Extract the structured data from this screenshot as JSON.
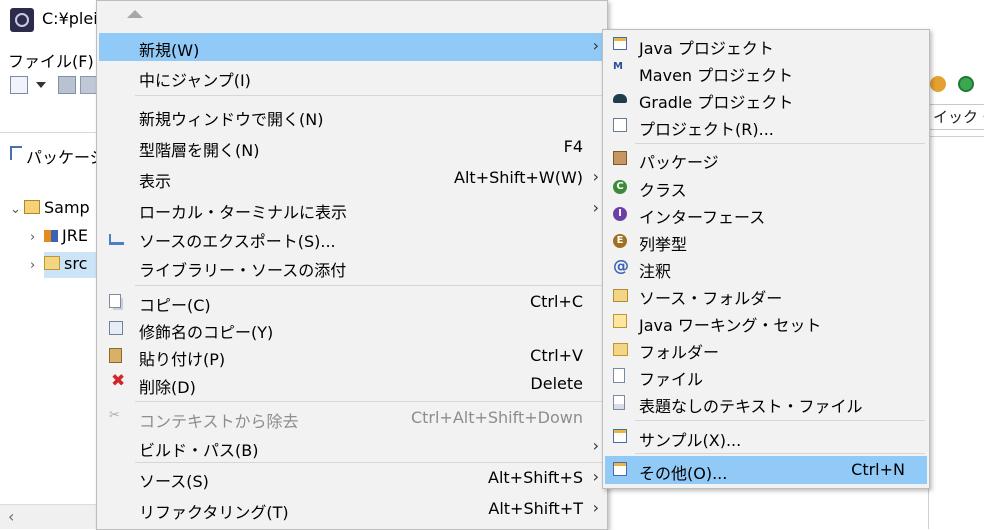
{
  "window": {
    "title": "C:¥plei",
    "menu_file": "ファイル(F)",
    "quick_access": "イック・ア",
    "package_tab": "パッケージ",
    "tree": {
      "project": "Samp",
      "jre": "JRE",
      "src": "src"
    }
  },
  "context_menu": {
    "items": [
      {
        "label": "新規(W)",
        "shortcut": "",
        "submenu": true
      },
      {
        "label": "中にジャンプ(I)",
        "shortcut": ""
      },
      {
        "label": "新規ウィンドウで開く(N)",
        "shortcut": ""
      },
      {
        "label": "型階層を開く(N)",
        "shortcut": "F4"
      },
      {
        "label": "表示",
        "shortcut": "Alt+Shift+W(W)",
        "submenu": true
      },
      {
        "label": "ローカル・ターミナルに表示",
        "shortcut": "",
        "submenu": true
      },
      {
        "label": "ソースのエクスポート(S)...",
        "shortcut": ""
      },
      {
        "label": "ライブラリー・ソースの添付",
        "shortcut": ""
      },
      {
        "label": "コピー(C)",
        "shortcut": "Ctrl+C"
      },
      {
        "label": "修飾名のコピー(Y)",
        "shortcut": ""
      },
      {
        "label": "貼り付け(P)",
        "shortcut": "Ctrl+V"
      },
      {
        "label": "削除(D)",
        "shortcut": "Delete"
      },
      {
        "label": "コンテキストから除去",
        "shortcut": "Ctrl+Alt+Shift+Down",
        "disabled": true
      },
      {
        "label": "ビルド・パス(B)",
        "shortcut": "",
        "submenu": true
      },
      {
        "label": "ソース(S)",
        "shortcut": "Alt+Shift+S",
        "submenu": true
      },
      {
        "label": "リファクタリング(T)",
        "shortcut": "Alt+Shift+T",
        "submenu": true
      }
    ],
    "submenu_arrow": "›"
  },
  "new_submenu": {
    "items": [
      {
        "label": "Java プロジェクト"
      },
      {
        "label": "Maven プロジェクト"
      },
      {
        "label": "Gradle プロジェクト"
      },
      {
        "label": "プロジェクト(R)..."
      },
      {
        "label": "パッケージ"
      },
      {
        "label": "クラス"
      },
      {
        "label": "インターフェース"
      },
      {
        "label": "列挙型"
      },
      {
        "label": "注釈"
      },
      {
        "label": "ソース・フォルダー"
      },
      {
        "label": "Java ワーキング・セット"
      },
      {
        "label": "フォルダー"
      },
      {
        "label": "ファイル"
      },
      {
        "label": "表題なしのテキスト・ファイル"
      },
      {
        "label": "サンプル(X)..."
      },
      {
        "label": "その他(O)...",
        "shortcut": "Ctrl+N"
      }
    ]
  },
  "icons": {
    "delete": "✖",
    "maven": "M",
    "class": "C",
    "interface": "I",
    "enum": "E",
    "annotation": "@",
    "scroll_left": "‹",
    "twisty_open": "⌄",
    "twisty_closed": "›"
  },
  "colors": {
    "highlight": "#91c9f7",
    "menu_bg": "#f2f2f2",
    "disabled_text": "#8d8d8d"
  }
}
